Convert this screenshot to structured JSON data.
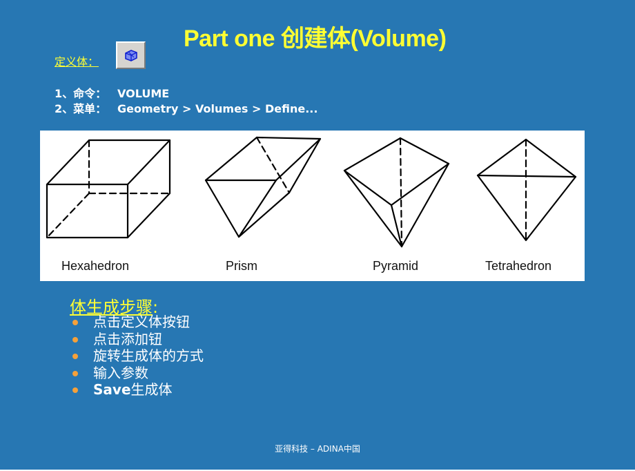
{
  "slide": {
    "title": "Part one  创建体(Volume)",
    "define_label": "定义体：",
    "define_button_icon": "volume-define-icon",
    "commands": [
      {
        "label": "1、命令：",
        "value": "VOLUME"
      },
      {
        "label": "2、菜单：",
        "value": "Geometry > Volumes > Define..."
      }
    ],
    "shapes": [
      {
        "label": "Hexahedron"
      },
      {
        "label": "Prism"
      },
      {
        "label": "Pyramid"
      },
      {
        "label": "Tetrahedron"
      }
    ],
    "steps_title": "体生成步骤",
    "steps_colon": ":",
    "steps": [
      {
        "text": "点击定义体按钮"
      },
      {
        "text": "点击添加钮"
      },
      {
        "text": "旋转生成体的方式"
      },
      {
        "text": "输入参数"
      },
      {
        "bold": "Save",
        "text": "生成体"
      }
    ],
    "footer": "亚得科技 – ADINA中国",
    "colors": {
      "background": "#2777b3",
      "title": "#ffff33",
      "bullet": "#f5a13a",
      "text": "#ffffff"
    }
  }
}
